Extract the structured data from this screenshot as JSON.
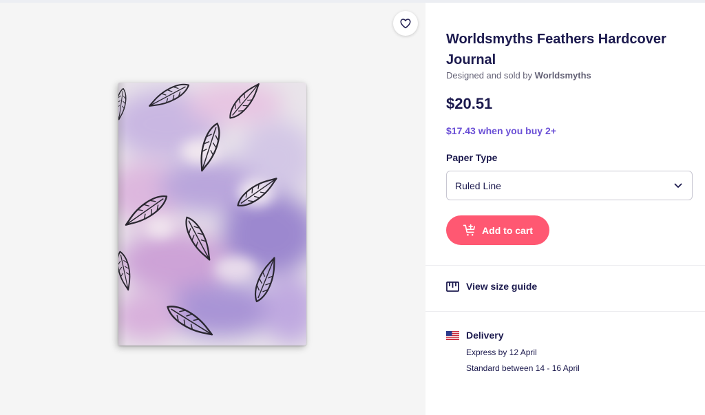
{
  "product": {
    "title": "Worldsmyths Feathers Hardcover Journal",
    "byline_prefix": "Designed and sold by",
    "seller": "Worldsmyths",
    "price": "$20.51",
    "bulk_offer": "$17.43 when you buy 2+"
  },
  "options": {
    "paper_type_label": "Paper Type",
    "paper_type_value": "Ruled Line"
  },
  "actions": {
    "add_to_cart_label": "Add to cart",
    "favorite_icon": "heart-icon"
  },
  "size_guide": {
    "label": "View size guide",
    "icon": "ruler-icon"
  },
  "delivery": {
    "label": "Delivery",
    "flag_icon": "us-flag-icon",
    "express": "Express by 12 April",
    "standard": "Standard between 14 - 16 April"
  },
  "colors": {
    "accent_cart": "#ff5872",
    "promo_purple": "#6a4fd6",
    "heading_navy": "#1c1a4e"
  }
}
